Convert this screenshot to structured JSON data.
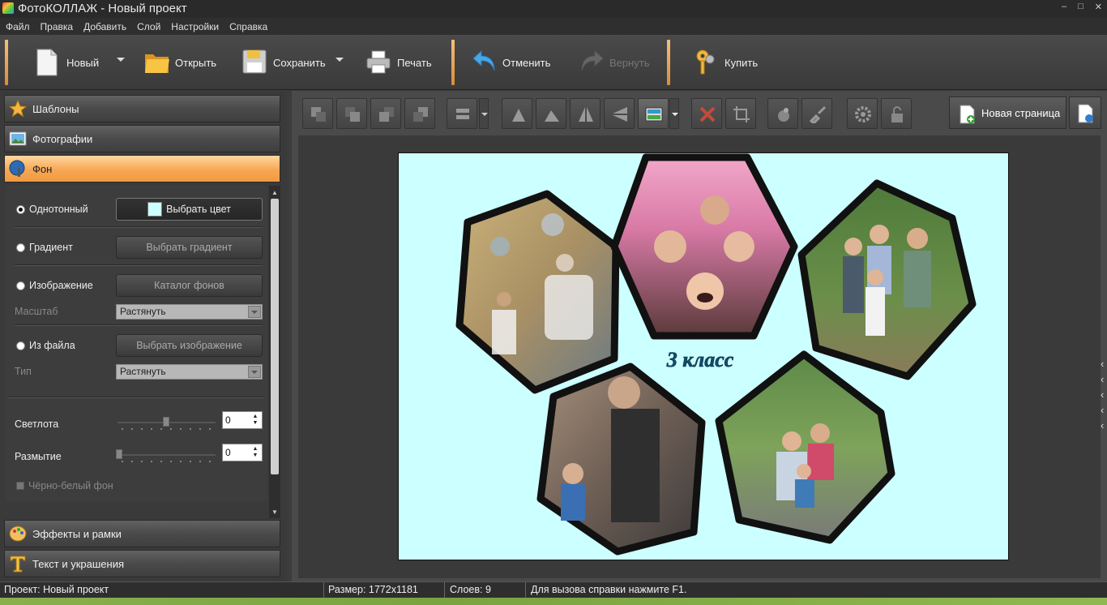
{
  "window": {
    "title": "ФотоКОЛЛАЖ - Новый проект"
  },
  "menu": [
    "Файл",
    "Правка",
    "Добавить",
    "Слой",
    "Настройки",
    "Справка"
  ],
  "toolbar": {
    "new": "Новый",
    "open": "Открыть",
    "save": "Сохранить",
    "print": "Печать",
    "undo": "Отменить",
    "redo": "Вернуть",
    "buy": "Купить"
  },
  "left_panel": {
    "templates": "Шаблоны",
    "photos": "Фотографии",
    "background": "Фон",
    "effects": "Эффекты и рамки",
    "text": "Текст и украшения",
    "solid": "Однотонный",
    "pick_color": "Выбрать цвет",
    "gradient": "Градиент",
    "pick_gradient": "Выбрать градиент",
    "image": "Изображение",
    "bg_catalog": "Каталог фонов",
    "scale_label": "Масштаб",
    "scale_value": "Растянуть",
    "from_file": "Из файла",
    "pick_image": "Выбрать изображение",
    "type_label": "Тип",
    "type_value": "Растянуть",
    "brightness_label": "Светлота",
    "brightness_value": "0",
    "blur_label": "Размытие",
    "blur_value": "0",
    "bw_label": "Чёрно-белый фон",
    "selected_color": "#ccffff"
  },
  "workarea": {
    "new_page": "Новая страница",
    "canvas_bg": "#ccffff",
    "caption": "3 класс"
  },
  "status": {
    "project": "Проект:  Новый проект",
    "size": "Размер:  1772x1181",
    "layers": "Слоев:  9",
    "help": "Для вызова справки нажмите F1."
  }
}
